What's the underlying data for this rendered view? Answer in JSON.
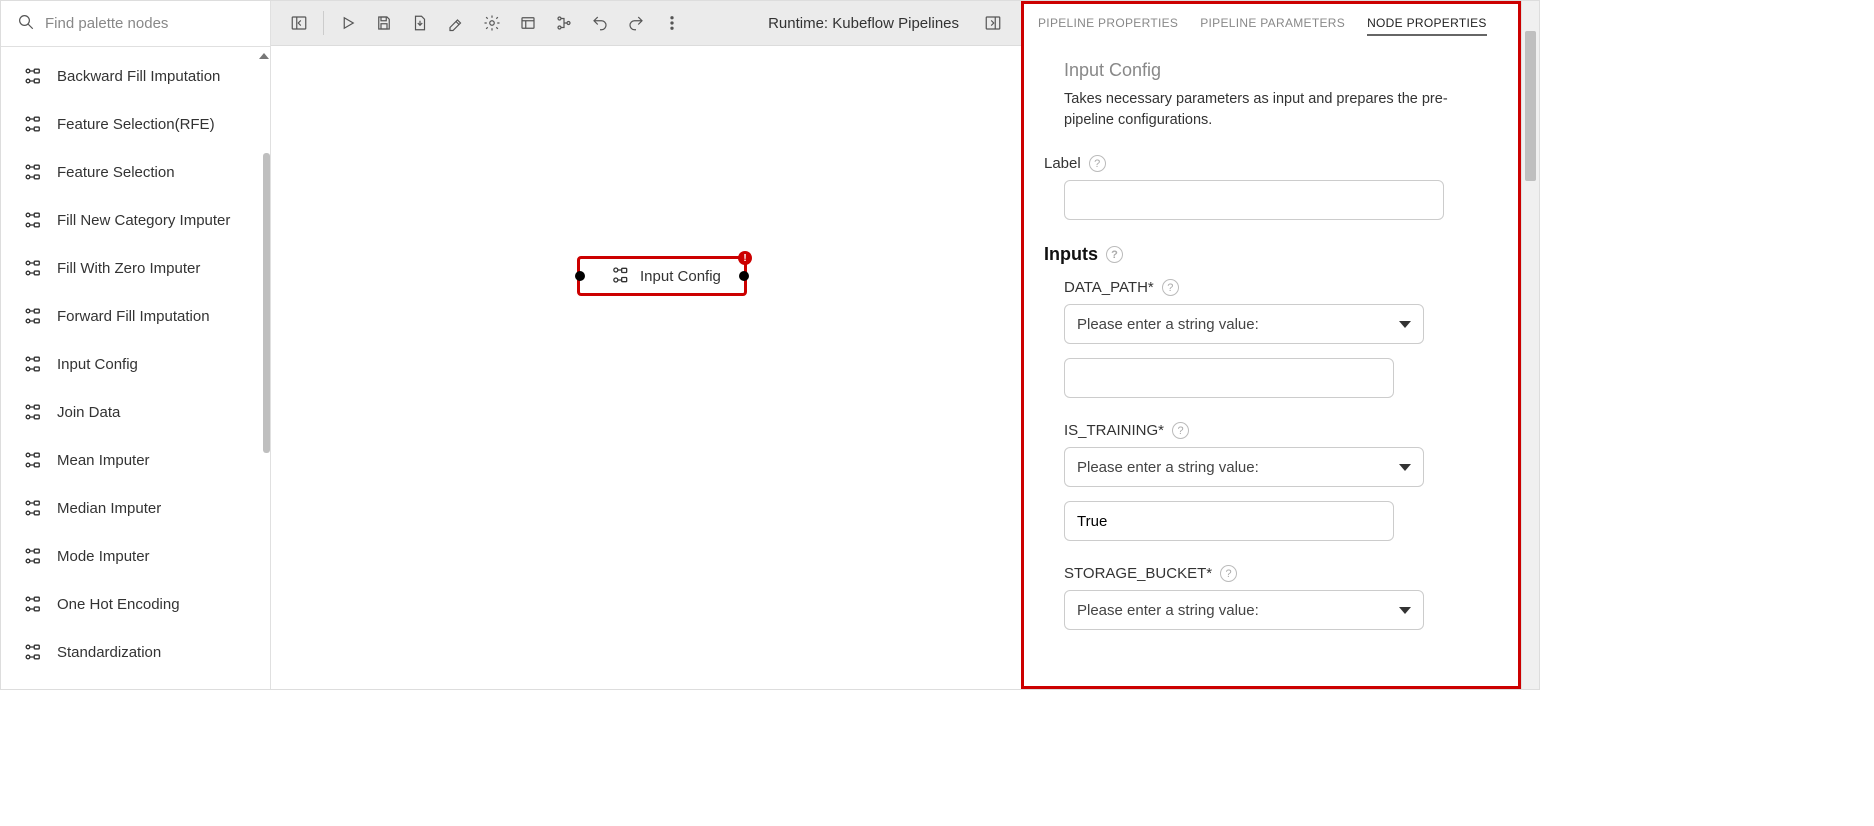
{
  "palette": {
    "search_placeholder": "Find palette nodes",
    "items": [
      "Backward Fill Imputation",
      "Feature Selection(RFE)",
      "Feature Selection",
      "Fill New Category Imputer",
      "Fill With Zero Imputer",
      "Forward Fill Imputation",
      "Input Config",
      "Join Data",
      "Mean Imputer",
      "Median Imputer",
      "Mode Imputer",
      "One Hot Encoding",
      "Standardization"
    ]
  },
  "toolbar": {
    "runtime": "Runtime: Kubeflow Pipelines"
  },
  "canvas": {
    "node_label": "Input Config"
  },
  "panel": {
    "tabs": [
      "PIPELINE PROPERTIES",
      "PIPELINE PARAMETERS",
      "NODE PROPERTIES"
    ],
    "title": "Input Config",
    "description": "Takes necessary parameters as input and prepares the pre-pipeline configurations.",
    "label_field": "Label",
    "inputs_header": "Inputs",
    "data_path_label": "DATA_PATH*",
    "is_training_label": "IS_TRAINING*",
    "storage_bucket_label": "STORAGE_BUCKET*",
    "select_placeholder": "Please enter a string value:",
    "is_training_value": "True"
  }
}
